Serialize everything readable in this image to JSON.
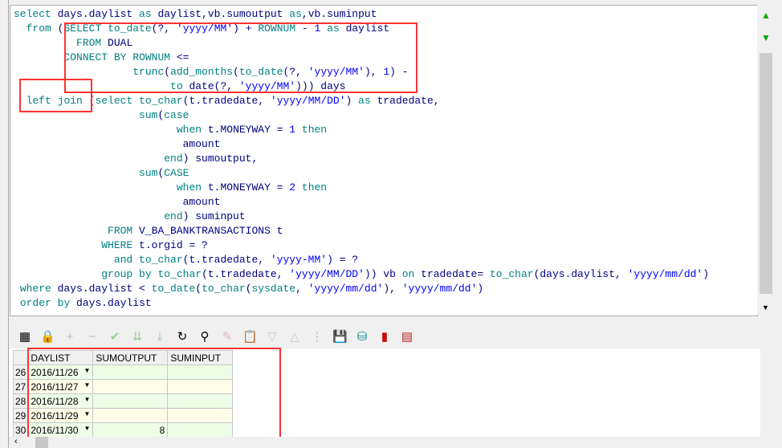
{
  "editor": {
    "lines": [
      "select days.daylist as daylist,vb.sumoutput as,vb.suminput",
      "  from (SELECT to_date(?, 'yyyy/MM') + ROWNUM - 1 as daylist",
      "          FROM DUAL",
      "        CONNECT BY ROWNUM <=",
      "                   trunc(add_months(to_date(?, 'yyyy/MM'), 1) -",
      "                         to date(?, 'yyyy/MM'))) days",
      "  left join (select to_char(t.tradedate, 'yyyy/MM/DD') as tradedate,",
      "                    sum(case",
      "                          when t.MONEYWAY = 1 then",
      "                           amount",
      "                        end) sumoutput,",
      "                    sum(CASE",
      "                          when t.MONEYWAY = 2 then",
      "                           amount",
      "                        end) suminput",
      "               FROM V_BA_BANKTRANSACTIONS t",
      "              WHERE t.orgid = ?",
      "                and to_char(t.tradedate, 'yyyy-MM') = ?",
      "              group by to_char(t.tradedate, 'yyyy/MM/DD')) vb on tradedate= to_char(days.daylist, 'yyyy/mm/dd')",
      " where days.daylist < to_date(to_char(sysdate, 'yyyy/mm/dd'), 'yyyy/mm/dd')",
      " order by days.daylist"
    ]
  },
  "toolbar": {
    "icons": [
      "grid-layout-icon",
      "lock-icon",
      "add-icon",
      "remove-icon",
      "check-icon",
      "next-page-icon",
      "last-page-icon",
      "refresh-icon",
      "find-icon",
      "clear-icon",
      "query-by-example-icon",
      "sort-down-icon",
      "sort-up-icon",
      "tree-icon",
      "save-icon",
      "export-icon",
      "chart-icon",
      "table-icon"
    ]
  },
  "grid": {
    "columns": [
      "DAYLIST",
      "SUMOUTPUT",
      "SUMINPUT"
    ],
    "rows": [
      {
        "n": "26",
        "daylist": "2016/11/26",
        "sumoutput": "",
        "suminput": ""
      },
      {
        "n": "27",
        "daylist": "2016/11/27",
        "sumoutput": "",
        "suminput": ""
      },
      {
        "n": "28",
        "daylist": "2016/11/28",
        "sumoutput": "",
        "suminput": ""
      },
      {
        "n": "29",
        "daylist": "2016/11/29",
        "sumoutput": "",
        "suminput": ""
      },
      {
        "n": "30",
        "daylist": "2016/11/30",
        "sumoutput": "8",
        "suminput": ""
      }
    ]
  },
  "colors": {
    "keyword": "#008080",
    "identifier": "#000080",
    "string": "#0000ff",
    "highlight": "#ff3333"
  }
}
